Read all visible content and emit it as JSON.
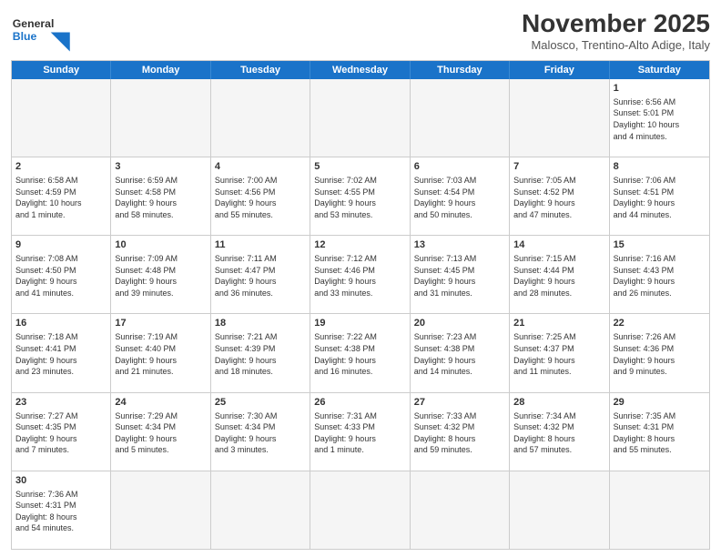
{
  "header": {
    "logo_general": "General",
    "logo_blue": "Blue",
    "month_title": "November 2025",
    "subtitle": "Malosco, Trentino-Alto Adige, Italy"
  },
  "days_of_week": [
    "Sunday",
    "Monday",
    "Tuesday",
    "Wednesday",
    "Thursday",
    "Friday",
    "Saturday"
  ],
  "cells": [
    {
      "day": "",
      "empty": true,
      "text": ""
    },
    {
      "day": "",
      "empty": true,
      "text": ""
    },
    {
      "day": "",
      "empty": true,
      "text": ""
    },
    {
      "day": "",
      "empty": true,
      "text": ""
    },
    {
      "day": "",
      "empty": true,
      "text": ""
    },
    {
      "day": "",
      "empty": true,
      "text": ""
    },
    {
      "day": "1",
      "empty": false,
      "text": "Sunrise: 6:56 AM\nSunset: 5:01 PM\nDaylight: 10 hours\nand 4 minutes."
    },
    {
      "day": "2",
      "empty": false,
      "text": "Sunrise: 6:58 AM\nSunset: 4:59 PM\nDaylight: 10 hours\nand 1 minute."
    },
    {
      "day": "3",
      "empty": false,
      "text": "Sunrise: 6:59 AM\nSunset: 4:58 PM\nDaylight: 9 hours\nand 58 minutes."
    },
    {
      "day": "4",
      "empty": false,
      "text": "Sunrise: 7:00 AM\nSunset: 4:56 PM\nDaylight: 9 hours\nand 55 minutes."
    },
    {
      "day": "5",
      "empty": false,
      "text": "Sunrise: 7:02 AM\nSunset: 4:55 PM\nDaylight: 9 hours\nand 53 minutes."
    },
    {
      "day": "6",
      "empty": false,
      "text": "Sunrise: 7:03 AM\nSunset: 4:54 PM\nDaylight: 9 hours\nand 50 minutes."
    },
    {
      "day": "7",
      "empty": false,
      "text": "Sunrise: 7:05 AM\nSunset: 4:52 PM\nDaylight: 9 hours\nand 47 minutes."
    },
    {
      "day": "8",
      "empty": false,
      "text": "Sunrise: 7:06 AM\nSunset: 4:51 PM\nDaylight: 9 hours\nand 44 minutes."
    },
    {
      "day": "9",
      "empty": false,
      "text": "Sunrise: 7:08 AM\nSunset: 4:50 PM\nDaylight: 9 hours\nand 41 minutes."
    },
    {
      "day": "10",
      "empty": false,
      "text": "Sunrise: 7:09 AM\nSunset: 4:48 PM\nDaylight: 9 hours\nand 39 minutes."
    },
    {
      "day": "11",
      "empty": false,
      "text": "Sunrise: 7:11 AM\nSunset: 4:47 PM\nDaylight: 9 hours\nand 36 minutes."
    },
    {
      "day": "12",
      "empty": false,
      "text": "Sunrise: 7:12 AM\nSunset: 4:46 PM\nDaylight: 9 hours\nand 33 minutes."
    },
    {
      "day": "13",
      "empty": false,
      "text": "Sunrise: 7:13 AM\nSunset: 4:45 PM\nDaylight: 9 hours\nand 31 minutes."
    },
    {
      "day": "14",
      "empty": false,
      "text": "Sunrise: 7:15 AM\nSunset: 4:44 PM\nDaylight: 9 hours\nand 28 minutes."
    },
    {
      "day": "15",
      "empty": false,
      "text": "Sunrise: 7:16 AM\nSunset: 4:43 PM\nDaylight: 9 hours\nand 26 minutes."
    },
    {
      "day": "16",
      "empty": false,
      "text": "Sunrise: 7:18 AM\nSunset: 4:41 PM\nDaylight: 9 hours\nand 23 minutes."
    },
    {
      "day": "17",
      "empty": false,
      "text": "Sunrise: 7:19 AM\nSunset: 4:40 PM\nDaylight: 9 hours\nand 21 minutes."
    },
    {
      "day": "18",
      "empty": false,
      "text": "Sunrise: 7:21 AM\nSunset: 4:39 PM\nDaylight: 9 hours\nand 18 minutes."
    },
    {
      "day": "19",
      "empty": false,
      "text": "Sunrise: 7:22 AM\nSunset: 4:38 PM\nDaylight: 9 hours\nand 16 minutes."
    },
    {
      "day": "20",
      "empty": false,
      "text": "Sunrise: 7:23 AM\nSunset: 4:38 PM\nDaylight: 9 hours\nand 14 minutes."
    },
    {
      "day": "21",
      "empty": false,
      "text": "Sunrise: 7:25 AM\nSunset: 4:37 PM\nDaylight: 9 hours\nand 11 minutes."
    },
    {
      "day": "22",
      "empty": false,
      "text": "Sunrise: 7:26 AM\nSunset: 4:36 PM\nDaylight: 9 hours\nand 9 minutes."
    },
    {
      "day": "23",
      "empty": false,
      "text": "Sunrise: 7:27 AM\nSunset: 4:35 PM\nDaylight: 9 hours\nand 7 minutes."
    },
    {
      "day": "24",
      "empty": false,
      "text": "Sunrise: 7:29 AM\nSunset: 4:34 PM\nDaylight: 9 hours\nand 5 minutes."
    },
    {
      "day": "25",
      "empty": false,
      "text": "Sunrise: 7:30 AM\nSunset: 4:34 PM\nDaylight: 9 hours\nand 3 minutes."
    },
    {
      "day": "26",
      "empty": false,
      "text": "Sunrise: 7:31 AM\nSunset: 4:33 PM\nDaylight: 9 hours\nand 1 minute."
    },
    {
      "day": "27",
      "empty": false,
      "text": "Sunrise: 7:33 AM\nSunset: 4:32 PM\nDaylight: 8 hours\nand 59 minutes."
    },
    {
      "day": "28",
      "empty": false,
      "text": "Sunrise: 7:34 AM\nSunset: 4:32 PM\nDaylight: 8 hours\nand 57 minutes."
    },
    {
      "day": "29",
      "empty": false,
      "text": "Sunrise: 7:35 AM\nSunset: 4:31 PM\nDaylight: 8 hours\nand 55 minutes."
    },
    {
      "day": "30",
      "empty": false,
      "text": "Sunrise: 7:36 AM\nSunset: 4:31 PM\nDaylight: 8 hours\nand 54 minutes."
    },
    {
      "day": "",
      "empty": true,
      "text": ""
    },
    {
      "day": "",
      "empty": true,
      "text": ""
    },
    {
      "day": "",
      "empty": true,
      "text": ""
    },
    {
      "day": "",
      "empty": true,
      "text": ""
    },
    {
      "day": "",
      "empty": true,
      "text": ""
    },
    {
      "day": "",
      "empty": true,
      "text": ""
    }
  ]
}
